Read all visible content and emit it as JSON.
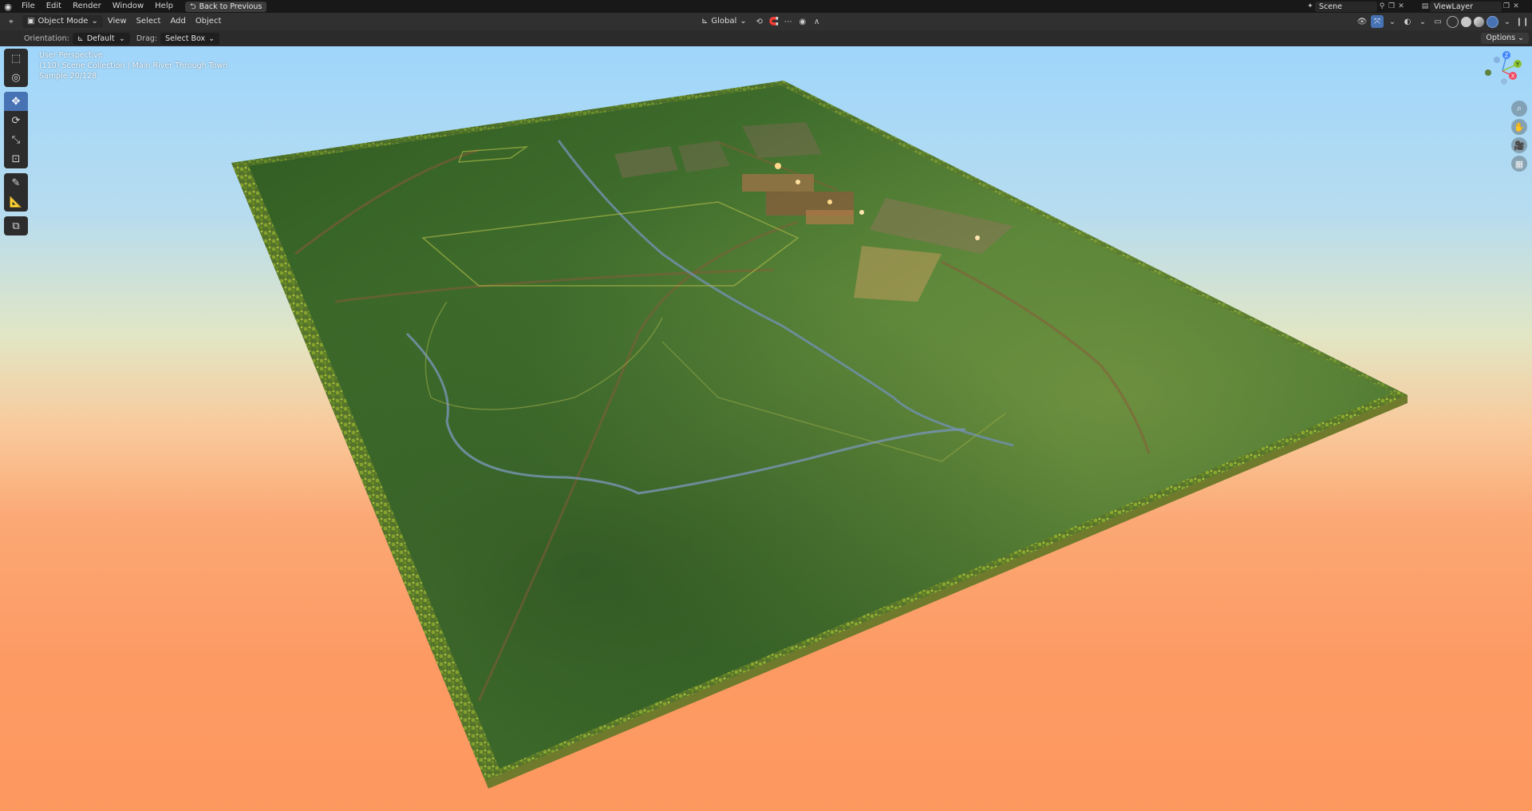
{
  "topbar": {
    "menus": [
      "File",
      "Edit",
      "Render",
      "Window",
      "Help"
    ],
    "back_button": "Back to Previous",
    "scene_name": "Scene",
    "view_layer": "ViewLayer"
  },
  "header": {
    "mode": "Object Mode",
    "menus": [
      "View",
      "Select",
      "Add",
      "Object"
    ],
    "transform_orientation": "Global"
  },
  "tool_settings": {
    "orientation_label": "Orientation:",
    "orientation_value": "Default",
    "drag_label": "Drag:",
    "drag_value": "Select Box",
    "options": "Options"
  },
  "viewport": {
    "perspective": "User Perspective",
    "collection_path": "(110) Scene Collection | Main River Through Town",
    "sample": "Sample 20/128",
    "gizmo_axes": [
      "Z",
      "Y",
      "X"
    ]
  },
  "colors": {
    "accent": "#4772b3",
    "sky_top": "#9fd6fb",
    "sky_bottom": "#fd985f",
    "terrain": "#3f6b2a"
  }
}
